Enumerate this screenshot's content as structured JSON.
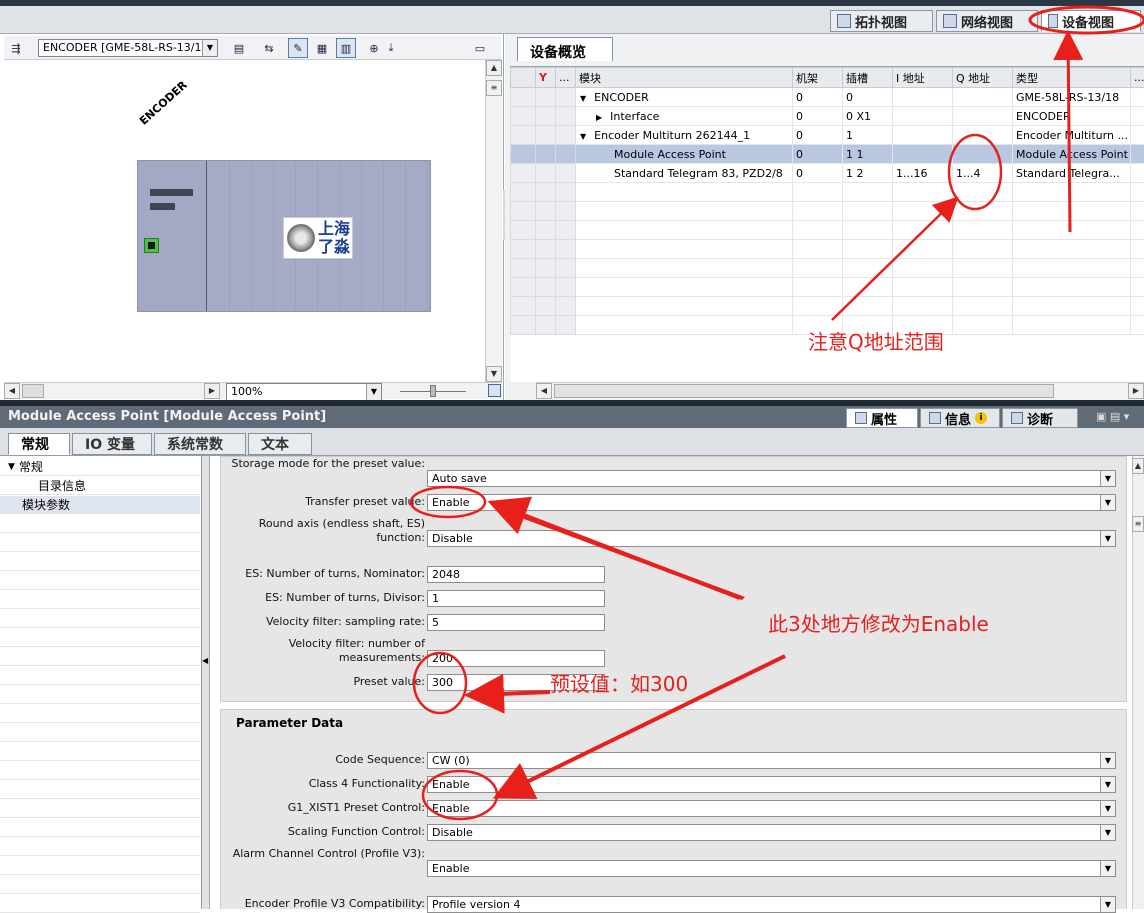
{
  "view_tabs": {
    "topology": "拓扑视图",
    "network": "网络视图",
    "device": "设备视图"
  },
  "left_toolbar": {
    "device_select": "ENCODER [GME-58L-RS-13/18",
    "zoom_value": "100%"
  },
  "device_graphic": {
    "label": "ENCODER",
    "logo_line1": "上海",
    "logo_line2": "了淼"
  },
  "overview": {
    "tab_label": "设备概览",
    "columns": [
      "",
      "",
      "...",
      "模块",
      "机架",
      "插槽",
      "I 地址",
      "Q 地址",
      "类型",
      "..."
    ],
    "rows": [
      {
        "expander": "▼",
        "module": "ENCODER",
        "rack": "0",
        "slot": "0",
        "i_addr": "",
        "q_addr": "",
        "type": "GME-58L-RS-13/18",
        "indent": 0
      },
      {
        "expander": "▶",
        "module": "Interface",
        "rack": "0",
        "slot": "0 X1",
        "i_addr": "",
        "q_addr": "",
        "type": "ENCODER",
        "indent": 1
      },
      {
        "expander": "▼",
        "module": "Encoder Multiturn 262144_1",
        "rack": "0",
        "slot": "1",
        "i_addr": "",
        "q_addr": "",
        "type": "Encoder Multiturn ...",
        "indent": 0
      },
      {
        "expander": "",
        "module": "Module Access Point",
        "rack": "0",
        "slot": "1 1",
        "i_addr": "",
        "q_addr": "",
        "type": "Module Access Point",
        "indent": 2,
        "selected": true
      },
      {
        "expander": "",
        "module": "Standard Telegram 83, PZD2/8",
        "rack": "0",
        "slot": "1 2",
        "i_addr": "1...16",
        "q_addr": "1...4",
        "type": "Standard Telegra...",
        "indent": 2
      }
    ]
  },
  "properties": {
    "title": "Module Access Point [Module Access Point]",
    "tab_properties": "属性",
    "tab_info": "信息",
    "tab_diagnostics": "诊断",
    "subtabs": [
      "常规",
      "IO 变量",
      "系统常数",
      "文本"
    ],
    "nav": [
      {
        "label": "常规",
        "expander": "▼",
        "indent": 0
      },
      {
        "label": "目录信息",
        "expander": "",
        "indent": 1
      },
      {
        "label": "模块参数",
        "expander": "",
        "indent": 0,
        "selected": true
      }
    ],
    "params": [
      {
        "label": "Storage mode for the preset value:",
        "value": "Auto save",
        "kind": "select"
      },
      {
        "label": "Transfer preset value:",
        "value": "Enable",
        "kind": "select"
      },
      {
        "label": "Round axis (endless shaft, ES) function:",
        "value": "Disable",
        "kind": "select"
      },
      {
        "label": "ES: Number of turns, Nominator:",
        "value": "2048",
        "kind": "text"
      },
      {
        "label": "ES: Number of turns, Divisor:",
        "value": "1",
        "kind": "text"
      },
      {
        "label": "Velocity filter: sampling rate:",
        "value": "5",
        "kind": "text"
      },
      {
        "label": "Velocity filter: number of measurements:",
        "value": "200",
        "kind": "text"
      },
      {
        "label": "Preset value:",
        "value": "300",
        "kind": "text"
      }
    ],
    "parameter_data_heading": "Parameter Data",
    "params2": [
      {
        "label": "Code Sequence:",
        "value": "CW (0)",
        "kind": "select"
      },
      {
        "label": "Class 4 Functionality:",
        "value": "Enable",
        "kind": "select"
      },
      {
        "label": "G1_XIST1 Preset Control:",
        "value": "Enable",
        "kind": "select"
      },
      {
        "label": "Scaling Function Control:",
        "value": "Disable",
        "kind": "select"
      },
      {
        "label": "Alarm Channel Control (Profile V3):",
        "value": "Enable",
        "kind": "select"
      },
      {
        "label": "Encoder Profile V3 Compatibility:",
        "value": "Profile version 4",
        "kind": "select"
      }
    ]
  },
  "annotations": {
    "q_address_note": "注意Q地址范围",
    "enable_note": "此3处地方修改为Enable",
    "preset_note": "预设值：如300"
  },
  "colors": {
    "annotation_red": "#e8201c",
    "selection": "#b9c7e3",
    "module_body": "#a3a8c4"
  }
}
